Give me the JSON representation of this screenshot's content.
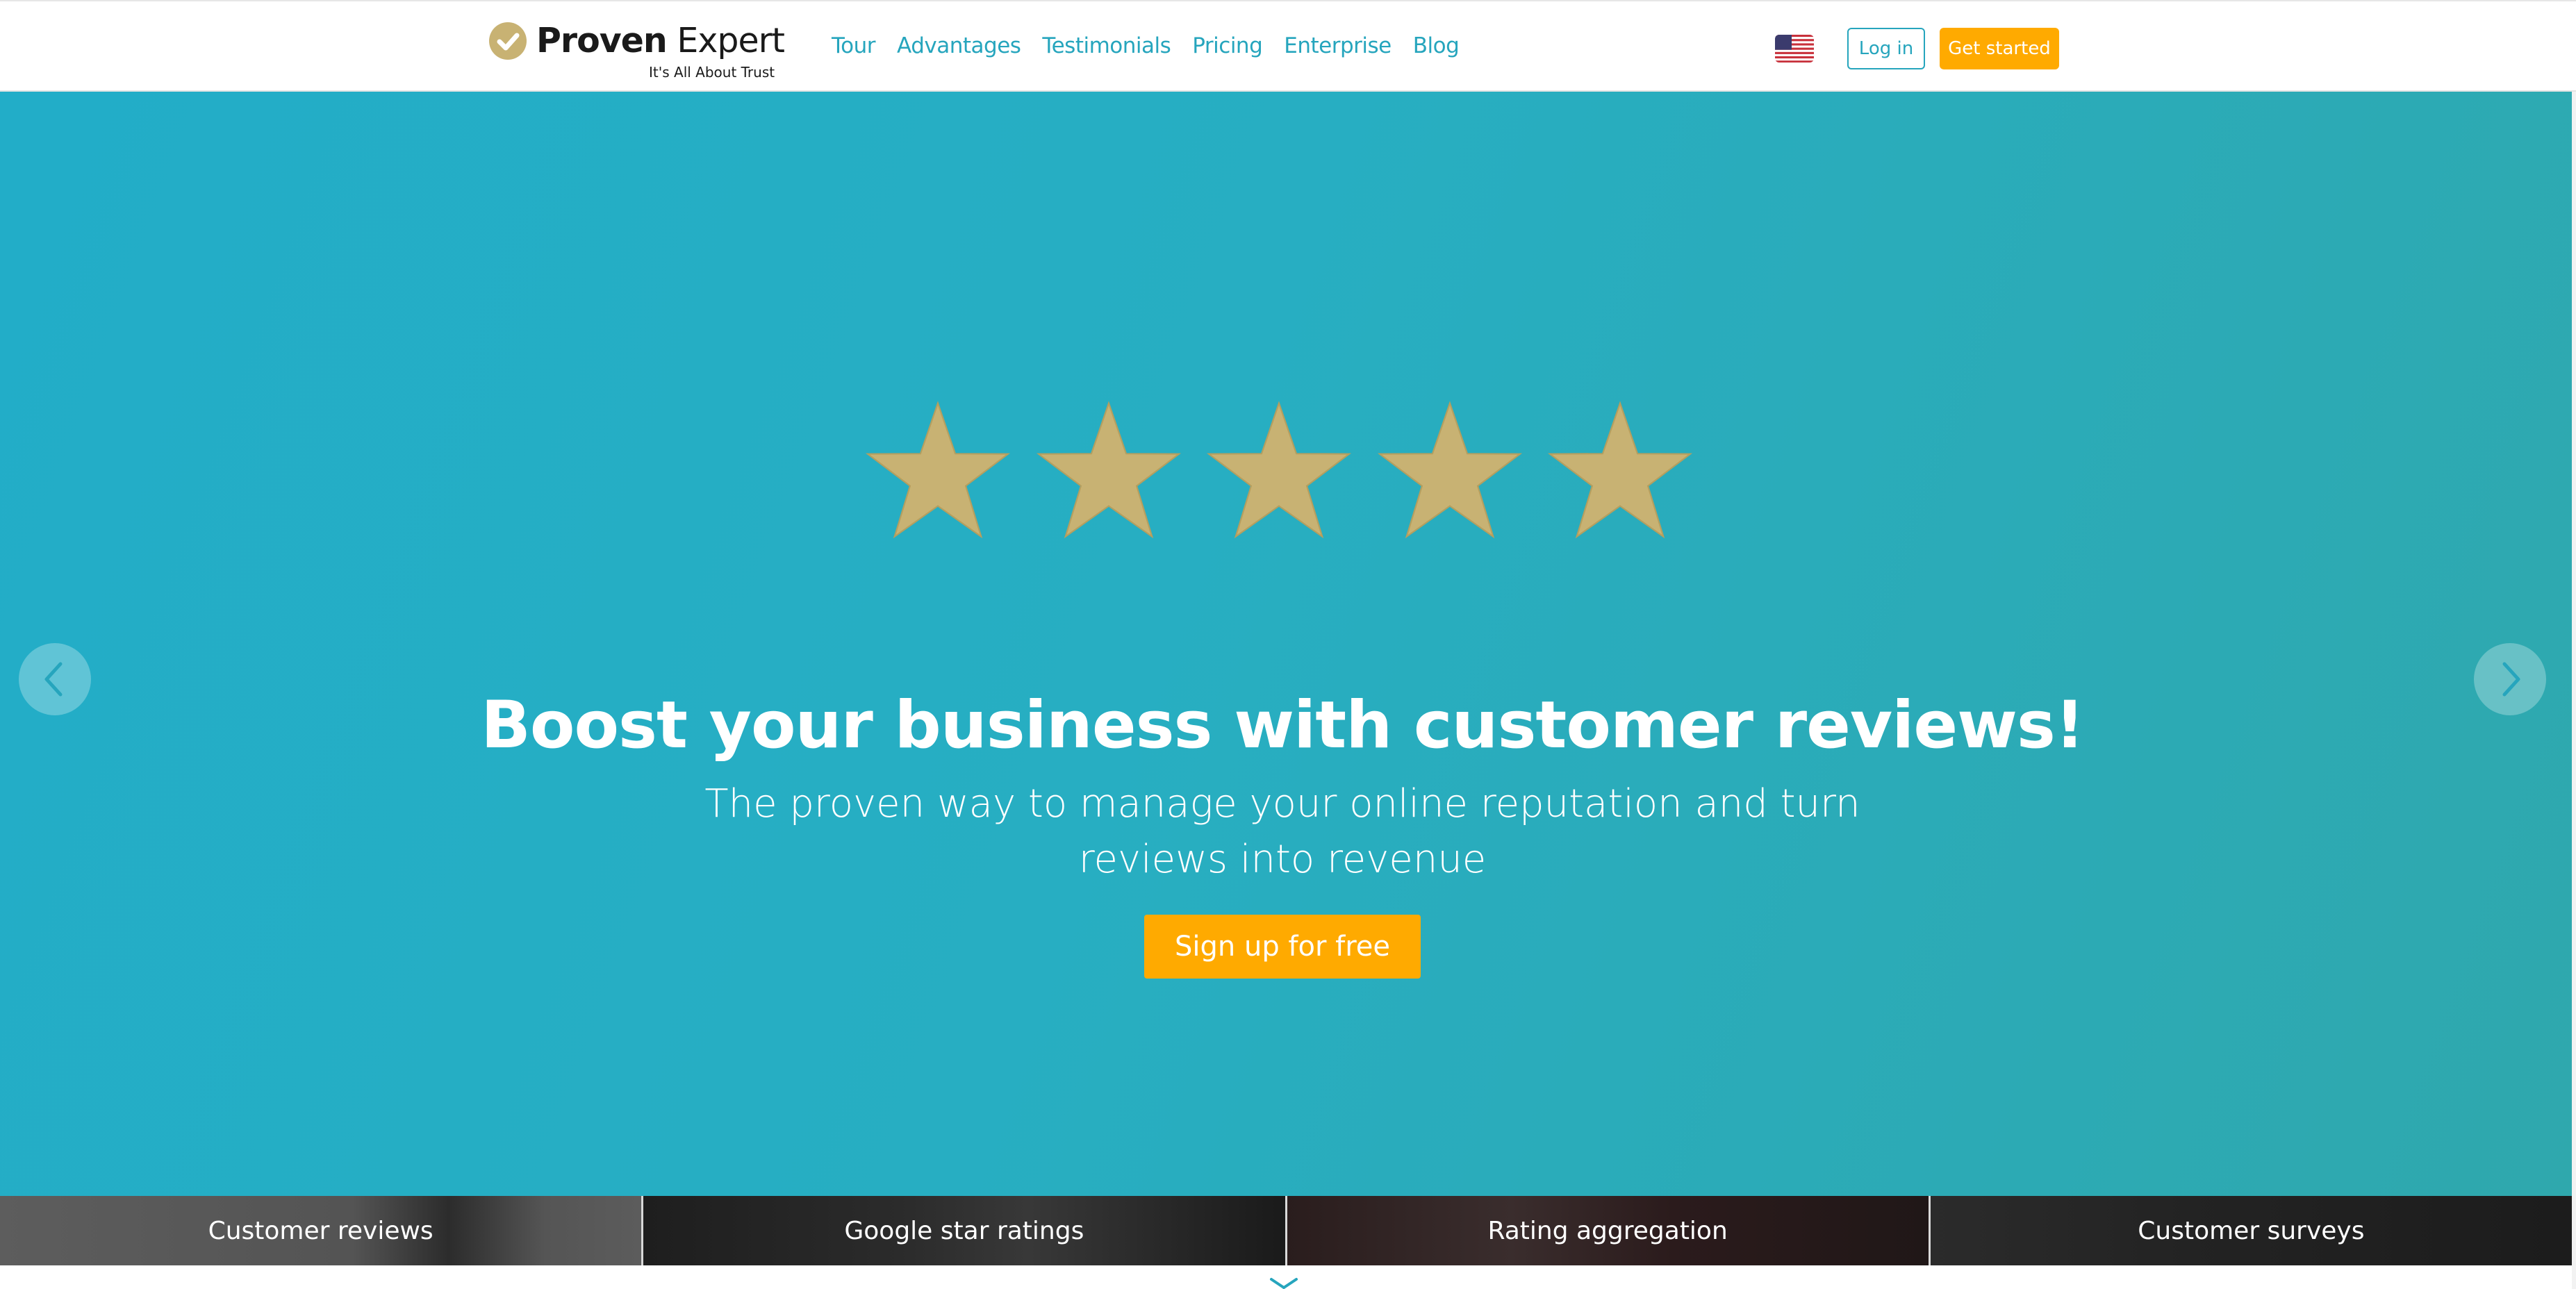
{
  "header": {
    "logo": {
      "brand_bold": "Proven",
      "brand_light": "Expert",
      "tagline": "It's All About Trust",
      "icon": "checkmark-badge-icon"
    },
    "nav": [
      {
        "label": "Tour"
      },
      {
        "label": "Advantages"
      },
      {
        "label": "Testimonials"
      },
      {
        "label": "Pricing"
      },
      {
        "label": "Enterprise"
      },
      {
        "label": "Blog"
      }
    ],
    "language_flag": "us-flag-icon",
    "login_label": "Log in",
    "get_started_label": "Get started"
  },
  "hero": {
    "rating_stars": 5,
    "headline": "Boost your business with customer reviews!",
    "subline": "The proven way to manage your online reputation and turn reviews into revenue",
    "cta_label": "Sign up for free",
    "prev_icon": "chevron-left-icon",
    "next_icon": "chevron-right-icon"
  },
  "tabs": [
    {
      "label": "Customer reviews"
    },
    {
      "label": "Google star ratings"
    },
    {
      "label": "Rating aggregation"
    },
    {
      "label": "Customer surveys"
    }
  ],
  "colors": {
    "accent": "#26a5bd",
    "cta": "#ffaa00",
    "star": "#c8b273",
    "hero_bg": "#27aec2"
  }
}
